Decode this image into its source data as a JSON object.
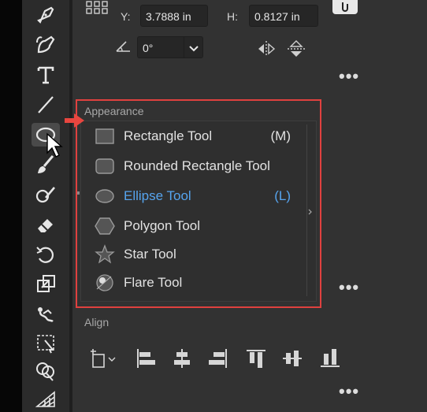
{
  "transform": {
    "y_label": "Y:",
    "y_value": "3.7888 in",
    "h_label": "H:",
    "h_value": "0.8127 in",
    "angle_value": "0°"
  },
  "appearance": {
    "title": "Appearance"
  },
  "shape_menu": {
    "items": [
      {
        "label": "Rectangle Tool",
        "shortcut": "(M)",
        "icon": "rectangle-icon"
      },
      {
        "label": "Rounded Rectangle Tool",
        "shortcut": "",
        "icon": "rounded-rectangle-icon"
      },
      {
        "label": "Ellipse Tool",
        "shortcut": "(L)",
        "icon": "ellipse-icon",
        "selected": true
      },
      {
        "label": "Polygon Tool",
        "shortcut": "",
        "icon": "polygon-icon"
      },
      {
        "label": "Star Tool",
        "shortcut": "",
        "icon": "star-icon"
      },
      {
        "label": "Flare Tool",
        "shortcut": "",
        "icon": "flare-icon"
      }
    ]
  },
  "align": {
    "title": "Align"
  },
  "colors": {
    "highlight_border": "#e0413f",
    "selected_text": "#56a4ee",
    "arrow": "#e8463f"
  },
  "toolbar": {
    "tools": [
      "pen-icon",
      "curvature-pen-icon",
      "type-icon",
      "line-segment-icon",
      "ellipse-tool-icon",
      "paintbrush-icon",
      "shaper-icon",
      "eraser-icon",
      "rotate-icon",
      "scale-icon",
      "puppet-warp-icon",
      "free-transform-icon",
      "shape-builder-icon",
      "perspective-grid-icon"
    ]
  }
}
